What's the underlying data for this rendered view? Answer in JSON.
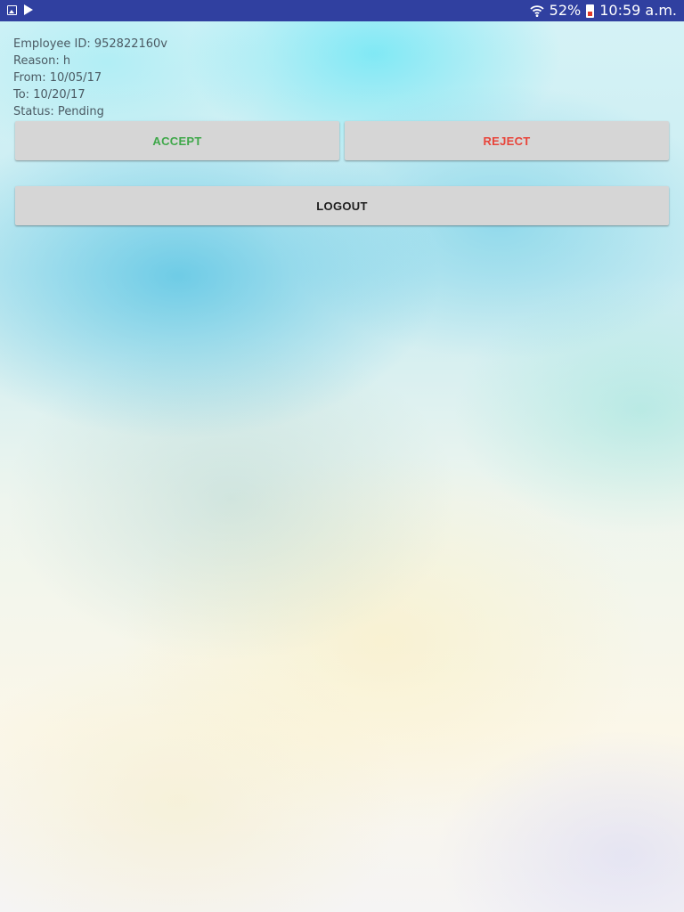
{
  "status_bar": {
    "battery": "52%",
    "time": "10:59 a.m.",
    "icons": [
      "image-notification-icon",
      "play-store-icon",
      "wifi-icon",
      "battery-icon"
    ]
  },
  "request": {
    "employee_id": "Employee ID: 952822160v",
    "reason": "Reason: h",
    "from": "From: 10/05/17",
    "to": "To: 10/20/17",
    "status": "Status: Pending"
  },
  "actions": {
    "accept_label": "ACCEPT",
    "reject_label": "REJECT",
    "logout_label": "LOGOUT"
  },
  "colors": {
    "status_bar": "#3040a0",
    "accept": "#3fa84a",
    "reject": "#e8443a",
    "button_bg": "#d6d6d6"
  }
}
